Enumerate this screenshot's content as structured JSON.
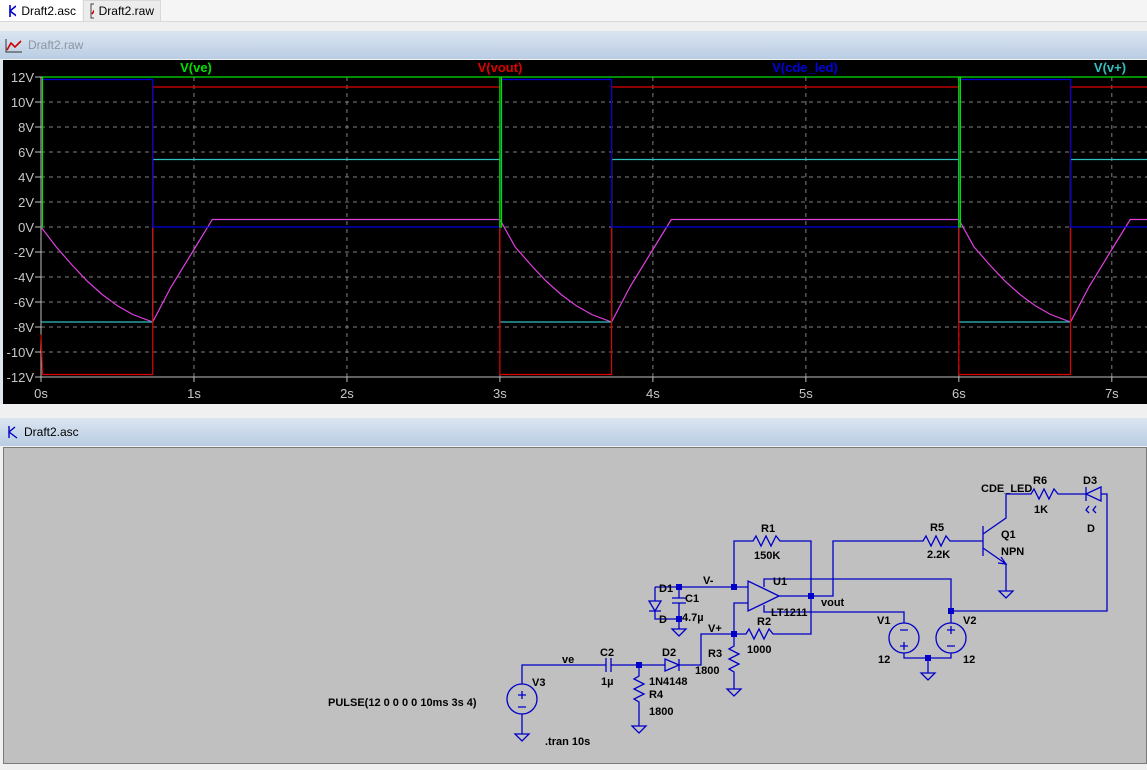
{
  "tabs": [
    {
      "label": "Draft2.asc",
      "icon": "schematic-icon",
      "active": true
    },
    {
      "label": "Draft2.raw",
      "icon": "waveform-icon",
      "active": false
    }
  ],
  "plot_window": {
    "title": "Draft2.raw",
    "icon": "waveform-icon"
  },
  "schematic_window": {
    "title": "Draft2.asc",
    "icon": "schematic-icon"
  },
  "chart_data": {
    "type": "line",
    "xlim": [
      0,
      7.23
    ],
    "ylim": [
      -12,
      12
    ],
    "x_ticks": [
      "0s",
      "1s",
      "2s",
      "3s",
      "4s",
      "5s",
      "6s",
      "7s"
    ],
    "x_tick_values": [
      0,
      1,
      2,
      3,
      4,
      5,
      6,
      7
    ],
    "y_ticks": [
      "12V",
      "10V",
      "8V",
      "6V",
      "4V",
      "2V",
      "0V",
      "-2V",
      "-4V",
      "-6V",
      "-8V",
      "-10V",
      "-12V"
    ],
    "y_tick_values": [
      12,
      10,
      8,
      6,
      4,
      2,
      0,
      -2,
      -4,
      -6,
      -8,
      -10,
      -12
    ],
    "grid": true,
    "background": "#000000",
    "series": [
      {
        "name": "V(ve)",
        "color": "#00e000",
        "points": [
          [
            0,
            0
          ],
          [
            0.01,
            0
          ],
          [
            0.01,
            12
          ],
          [
            3,
            12
          ],
          [
            3,
            0
          ],
          [
            3.01,
            0
          ],
          [
            3.01,
            12
          ],
          [
            6,
            12
          ],
          [
            6,
            0
          ],
          [
            6.01,
            0
          ],
          [
            6.01,
            12
          ],
          [
            7.23,
            12
          ]
        ]
      },
      {
        "name": "V(vout)",
        "color": "#e00000",
        "points": [
          [
            0,
            -8.6
          ],
          [
            0.01,
            -11.8
          ],
          [
            0.73,
            -11.8
          ],
          [
            0.73,
            11.2
          ],
          [
            3,
            11.2
          ],
          [
            3,
            -11.8
          ],
          [
            3.73,
            -11.8
          ],
          [
            3.73,
            11.2
          ],
          [
            6,
            11.2
          ],
          [
            6,
            -11.8
          ],
          [
            6.73,
            -11.8
          ],
          [
            6.73,
            11.2
          ],
          [
            7.23,
            11.2
          ]
        ]
      },
      {
        "name": "V(cde_led)",
        "color": "#0000e0",
        "points": [
          [
            0.01,
            11.8
          ],
          [
            0.73,
            11.8
          ],
          [
            0.73,
            0
          ],
          [
            3,
            0
          ],
          [
            3.01,
            11.8
          ],
          [
            3.73,
            11.8
          ],
          [
            3.73,
            0
          ],
          [
            6,
            0
          ],
          [
            6.01,
            11.8
          ],
          [
            6.73,
            11.8
          ],
          [
            6.73,
            0
          ],
          [
            7.23,
            0
          ]
        ]
      },
      {
        "name": "V(v+)",
        "color": "#30c0c0",
        "points": [
          [
            0,
            -7.6
          ],
          [
            0.73,
            -7.6
          ],
          [
            0.73,
            5.4
          ],
          [
            3,
            5.4
          ],
          [
            3,
            -7.6
          ],
          [
            3.73,
            -7.6
          ],
          [
            3.73,
            5.4
          ],
          [
            6,
            5.4
          ],
          [
            6,
            -7.6
          ],
          [
            6.73,
            -7.6
          ],
          [
            6.73,
            5.4
          ],
          [
            7.23,
            5.4
          ]
        ]
      },
      {
        "color": "#e040e0",
        "points": [
          [
            0,
            0
          ],
          [
            0.1,
            -1.6
          ],
          [
            0.2,
            -3.0
          ],
          [
            0.3,
            -4.3
          ],
          [
            0.4,
            -5.4
          ],
          [
            0.5,
            -6.3
          ],
          [
            0.6,
            -7.0
          ],
          [
            0.73,
            -7.6
          ],
          [
            0.85,
            -4.8
          ],
          [
            1.0,
            -1.8
          ],
          [
            1.12,
            0.6
          ],
          [
            3,
            0.6
          ],
          [
            3.1,
            -1.6
          ],
          [
            3.2,
            -3.0
          ],
          [
            3.3,
            -4.3
          ],
          [
            3.4,
            -5.4
          ],
          [
            3.5,
            -6.3
          ],
          [
            3.6,
            -7.0
          ],
          [
            3.73,
            -7.6
          ],
          [
            3.85,
            -4.8
          ],
          [
            4.0,
            -1.8
          ],
          [
            4.12,
            0.6
          ],
          [
            6,
            0.6
          ],
          [
            6.1,
            -1.6
          ],
          [
            6.2,
            -3.0
          ],
          [
            6.3,
            -4.3
          ],
          [
            6.4,
            -5.4
          ],
          [
            6.5,
            -6.3
          ],
          [
            6.6,
            -7.0
          ],
          [
            6.73,
            -7.6
          ],
          [
            6.85,
            -4.8
          ],
          [
            7.0,
            -1.8
          ],
          [
            7.12,
            0.6
          ],
          [
            7.23,
            0.6
          ]
        ]
      }
    ]
  },
  "schematic": {
    "wire_color": "#0000c8",
    "labels": {
      "R1": "R1",
      "R1v": "150K",
      "R2": "R2",
      "R2v": "1000",
      "R3": "R3",
      "R3v": "1800",
      "R4": "R4",
      "R4v": "1800",
      "R5": "R5",
      "R5v": "2.2K",
      "R6": "R6",
      "R6v": "1K",
      "C1": "C1",
      "C1v": "4.7µ",
      "C2": "C2",
      "C2v": "1µ",
      "D1": "D1",
      "D1v": "D",
      "D2": "D2",
      "D2v": "1N4148",
      "D3": "D3",
      "D3v": "D",
      "Q1": "Q1",
      "Q1v": "NPN",
      "U1": "U1",
      "U1v": "LT1211",
      "V1": "V1",
      "V1v": "12",
      "V2": "V2",
      "V2v": "12",
      "V3": "V3",
      "net_vminus": "V-",
      "net_vplus": "V+",
      "net_vout": "vout",
      "net_ve": "ve",
      "net_cde": "CDE_LED",
      "pulse": "PULSE(12 0 0 0 0 10ms 3s 4)",
      "tran": ".tran 10s"
    }
  }
}
